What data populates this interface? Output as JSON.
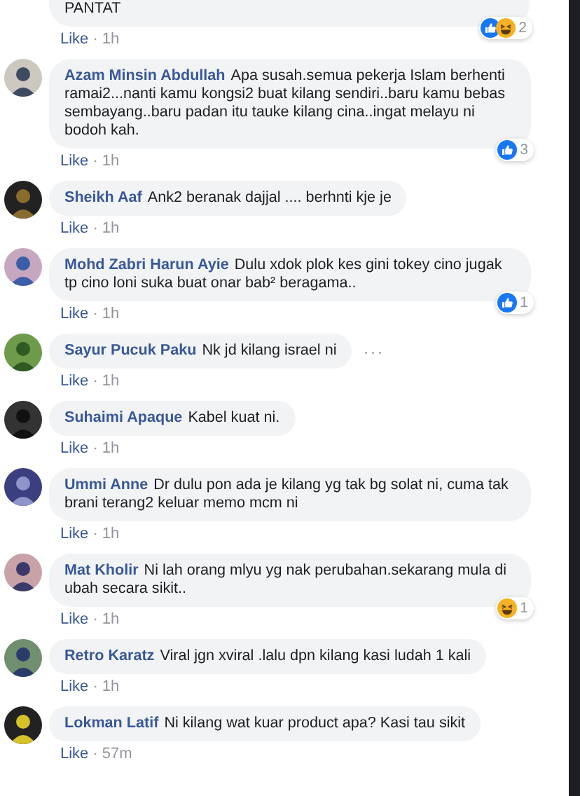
{
  "comments": [
    {
      "text": "PANTAT",
      "like": "Like",
      "separator": "·",
      "time": "1h",
      "reactions": [
        {
          "kind": "like"
        },
        {
          "kind": "haha"
        }
      ],
      "reaction_count": "2",
      "partial": true
    },
    {
      "name": "Azam Minsin Abdullah",
      "text": "Apa susah.semua pekerja Islam berhenti ramai2...nanti kamu kongsi2 buat kilang sendiri..baru kamu bebas sembayang..baru padan itu tauke kilang cina..ingat melayu ni bodoh kah.",
      "like": "Like",
      "separator": "·",
      "time": "1h",
      "reactions": [
        {
          "kind": "like"
        }
      ],
      "reaction_count": "3",
      "partial": false
    },
    {
      "name": "Sheikh Aaf",
      "text": "Ank2 beranak dajjal .... berhnti kje je",
      "like": "Like",
      "separator": "·",
      "time": "1h",
      "partial": false
    },
    {
      "name": "Mohd Zabri Harun Ayie",
      "text": "Dulu xdok plok kes gini tokey cino jugak tp cino loni suka buat onar bab² beragama..",
      "like": "Like",
      "separator": "·",
      "time": "1h",
      "reactions": [
        {
          "kind": "like"
        }
      ],
      "reaction_count": "1",
      "partial": false
    },
    {
      "name": "Sayur Pucuk Paku",
      "text": "Nk jd kilang israel ni",
      "like": "Like",
      "separator": "·",
      "time": "1h",
      "options": "···",
      "partial": false
    },
    {
      "name": "Suhaimi Apaque",
      "text": "Kabel kuat ni.",
      "like": "Like",
      "separator": "·",
      "time": "1h",
      "partial": false
    },
    {
      "name": "Ummi Anne",
      "text": "Dr dulu pon ada je kilang yg tak bg solat ni, cuma tak brani terang2 keluar memo mcm ni",
      "like": "Like",
      "separator": "·",
      "time": "1h",
      "partial": false
    },
    {
      "name": "Mat Kholir",
      "text": "Ni lah orang mlyu yg nak perubahan.sekarang mula di ubah secara sikit..",
      "like": "Like",
      "separator": "·",
      "time": "1h",
      "reactions": [
        {
          "kind": "haha"
        }
      ],
      "reaction_count": "1",
      "partial": false
    },
    {
      "name": "Retro Karatz",
      "text": "Viral jgn xviral .lalu dpn kilang kasi ludah 1 kali",
      "like": "Like",
      "separator": "·",
      "time": "1h",
      "partial": false
    },
    {
      "name": "Lokman Latif",
      "text": "Ni kilang wat kuar product apa? Kasi tau sikit",
      "like": "Like",
      "separator": "·",
      "time": "57m",
      "partial": false
    }
  ]
}
